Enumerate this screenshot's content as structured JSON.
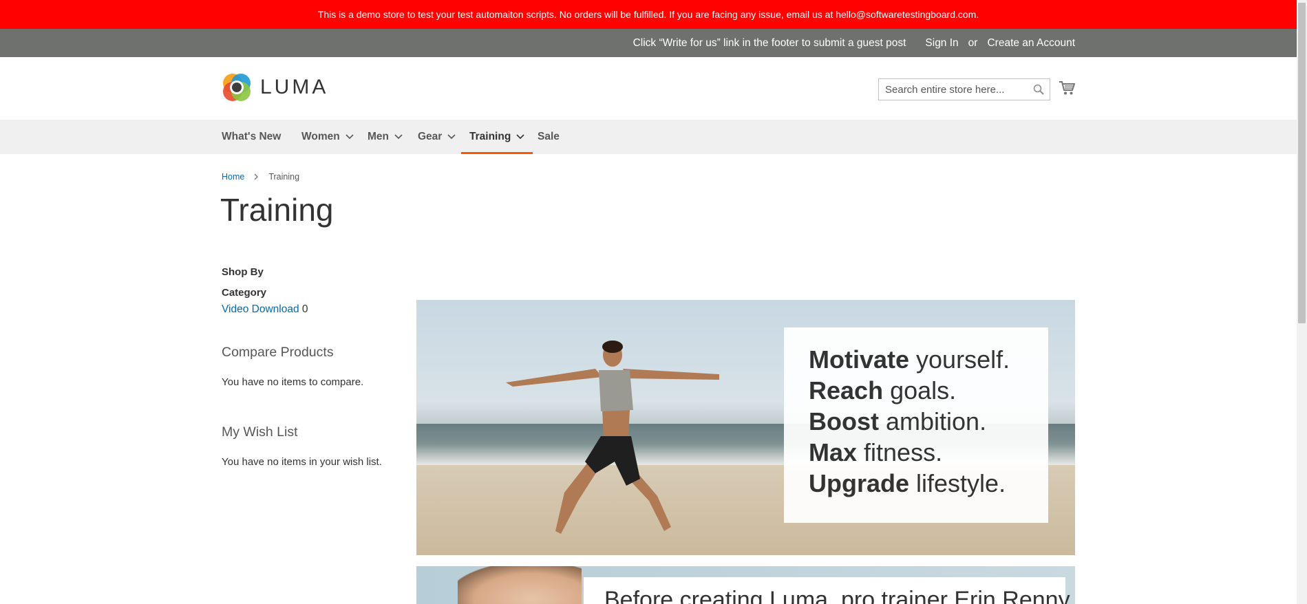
{
  "demo_notice": "This is a demo store to test your test automaiton scripts. No orders will be fulfilled. If you are facing any issue, email us at hello@softwaretestingboard.com.",
  "panel": {
    "guest_post": "Click “Write for us” link in the footer to submit a guest post",
    "sign_in": "Sign In",
    "or": "or",
    "create_account": "Create an Account"
  },
  "logo": {
    "text": "LUMA"
  },
  "search": {
    "placeholder": "Search entire store here..."
  },
  "nav": [
    {
      "label": "What's New"
    },
    {
      "label": "Women"
    },
    {
      "label": "Men"
    },
    {
      "label": "Gear"
    },
    {
      "label": "Training"
    },
    {
      "label": "Sale"
    }
  ],
  "breadcrumbs": {
    "home": "Home",
    "current": "Training"
  },
  "page_title": "Training",
  "sidebar": {
    "shop_by": "Shop By",
    "category_title": "Category",
    "category_link": "Video Download",
    "category_count": "0",
    "compare_title": "Compare Products",
    "compare_text": "You have no items to compare.",
    "wishlist_title": "My Wish List",
    "wishlist_text": "You have no items in your wish list."
  },
  "hero": {
    "lines": [
      {
        "bold": "Motivate",
        "rest": " yourself."
      },
      {
        "bold": "Reach",
        "rest": " goals."
      },
      {
        "bold": "Boost",
        "rest": " ambition."
      },
      {
        "bold": "Max",
        "rest": " fitness."
      },
      {
        "bold": "Upgrade",
        "rest": " lifestyle."
      }
    ]
  },
  "hero2": {
    "text": "Before creating Luma, pro trainer Erin Renny"
  },
  "colors": {
    "demo_bar": "#ff0101",
    "panel": "#6e716e",
    "link": "#006bb4",
    "nav_active": "#ff5501"
  }
}
